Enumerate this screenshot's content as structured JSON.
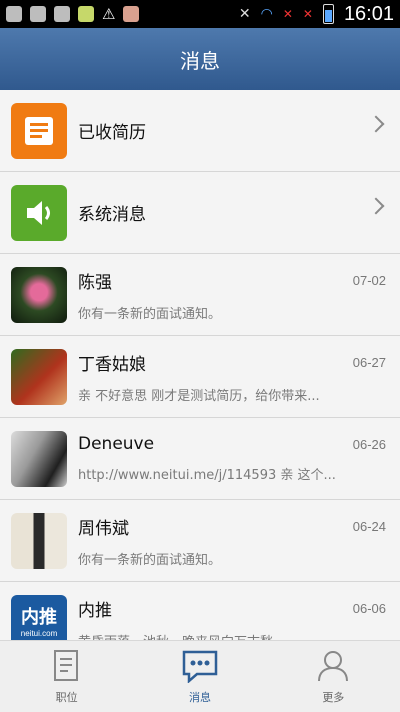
{
  "status_bar": {
    "time": "16:01",
    "icons": [
      "app-icon",
      "calendar-icon",
      "mail-icon",
      "app-icon",
      "warning-icon",
      "notification-icon",
      "mute-icon",
      "wifi-icon",
      "no-signal-icon",
      "no-signal-icon",
      "battery-icon"
    ]
  },
  "header": {
    "title": "消息"
  },
  "list": [
    {
      "title": "已收简历",
      "type": "system",
      "icon": "resume-icon",
      "accent": "#f07b12"
    },
    {
      "title": "系统消息",
      "type": "system",
      "icon": "speaker-icon",
      "accent": "#5aaa2b"
    },
    {
      "title": "陈强",
      "date": "07-02",
      "subtitle": "你有一条新的面试通知。",
      "avatar": "flower-photo"
    },
    {
      "title": "丁香姑娘",
      "date": "06-27",
      "subtitle": "亲 不好意思 刚才是测试简历，给你带来...",
      "avatar": "garden-photo"
    },
    {
      "title": "Deneuve",
      "date": "06-26",
      "subtitle": "http://www.neitui.me/j/114593 亲 这个...",
      "avatar": "portrait-photo"
    },
    {
      "title": "周伟斌",
      "date": "06-24",
      "subtitle": "你有一条新的面试通知。",
      "avatar": "person-photo"
    },
    {
      "title": "内推",
      "date": "06-06",
      "subtitle": "黄昏雨落一池秋，晚来风向万古愁。 ...",
      "avatar": "neitui-logo",
      "avatar_text": "内推",
      "avatar_subtext": "neitui.com"
    }
  ],
  "tabs": [
    {
      "label": "职位",
      "icon": "document-icon",
      "active": false
    },
    {
      "label": "消息",
      "icon": "chat-icon",
      "active": true
    },
    {
      "label": "更多",
      "icon": "user-icon",
      "active": false
    }
  ],
  "colors": {
    "header": "#3f6ba0",
    "active_tab": "#2f5f96"
  }
}
